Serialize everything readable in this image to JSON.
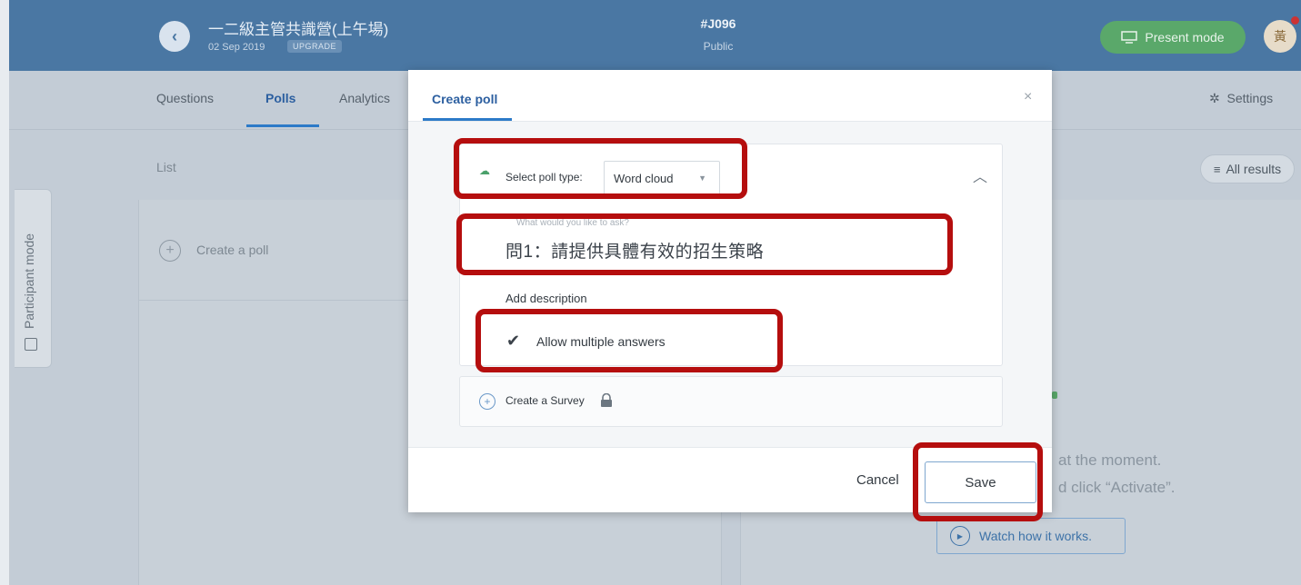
{
  "header": {
    "event_title": "一二級主管共識營(上午場)",
    "event_date": "02 Sep 2019",
    "upgrade_badge": "UPGRADE",
    "event_code": "#J096",
    "event_privacy": "Public",
    "present_mode_label": "Present mode",
    "avatar_initial": "黃",
    "accent_color": "#4a77a3",
    "present_color": "#5aa86a"
  },
  "tabs": {
    "questions": "Questions",
    "polls": "Polls",
    "analytics": "Analytics",
    "settings": "Settings",
    "active": "Polls"
  },
  "sidebar": {
    "participant_mode": "Participant mode"
  },
  "main": {
    "list_label": "List",
    "create_poll": "Create a poll",
    "all_results": "All results",
    "empty_msg_line1": "at the moment.",
    "empty_msg_line2": "d click “Activate”.",
    "watch_label": "Watch how it works."
  },
  "modal": {
    "tab_title": "Create poll",
    "close_symbol": "×",
    "poll_type_label": "Select poll type:",
    "poll_type_value": "Word cloud",
    "question_placeholder": "What would you like to ask?",
    "question_value": "問1：請提供具體有效的招生策略",
    "add_description": "Add description",
    "allow_multiple_label": "Allow multiple answers",
    "allow_multiple_checked": true,
    "create_survey": "Create a Survey",
    "cancel_label": "Cancel",
    "save_label": "Save"
  },
  "annotation_color": "#b50e0e"
}
